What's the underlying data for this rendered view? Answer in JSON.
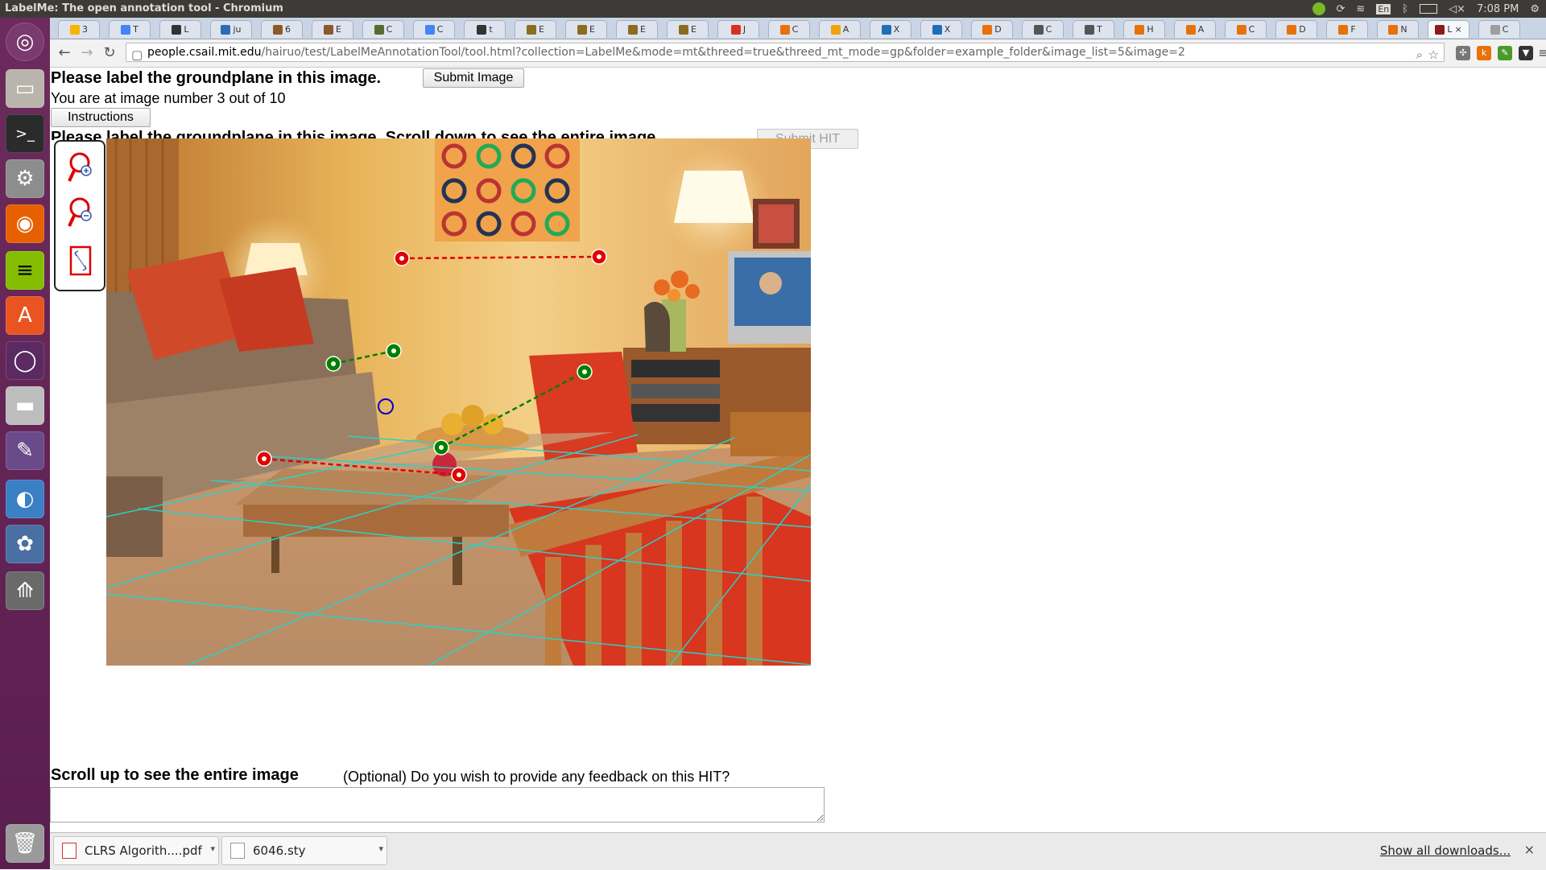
{
  "system_bar": {
    "window_title": "LabelMe: The open annotation tool - Chromium",
    "keyboard_indicator": "En",
    "clock": "7:08 PM"
  },
  "launcher": {
    "items": [
      "ubuntu-dash",
      "files",
      "terminal",
      "system-settings",
      "firefox",
      "spotify",
      "software-center",
      "unity-tweak",
      "drive",
      "text-editor",
      "chromium",
      "shotwell",
      "updater"
    ],
    "trash": "trash"
  },
  "tabs": [
    {
      "label": "3",
      "color": "#f4b400"
    },
    {
      "label": "T",
      "color": "#4285f4"
    },
    {
      "label": "L",
      "color": "#333333"
    },
    {
      "label": "ju",
      "color": "#2a6db5"
    },
    {
      "label": "6",
      "color": "#8b5a2b"
    },
    {
      "label": "E",
      "color": "#8b5a2b"
    },
    {
      "label": "C",
      "color": "#556b2f"
    },
    {
      "label": "C",
      "color": "#4285f4"
    },
    {
      "label": "t",
      "color": "#333333"
    },
    {
      "label": "E",
      "color": "#8a6d1e"
    },
    {
      "label": "E",
      "color": "#8a6d1e"
    },
    {
      "label": "E",
      "color": "#8a6d1e"
    },
    {
      "label": "E",
      "color": "#8a6d1e"
    },
    {
      "label": "J",
      "color": "#d93025"
    },
    {
      "label": "C",
      "color": "#e8710a"
    },
    {
      "label": "A",
      "color": "#f0a30a"
    },
    {
      "label": "X",
      "color": "#1f6fb5"
    },
    {
      "label": "X",
      "color": "#1f6fb5"
    },
    {
      "label": "D",
      "color": "#e8710a"
    },
    {
      "label": "C",
      "color": "#555555"
    },
    {
      "label": "T",
      "color": "#555555"
    },
    {
      "label": "H",
      "color": "#e8710a"
    },
    {
      "label": "A",
      "color": "#e8710a"
    },
    {
      "label": "C",
      "color": "#e8710a"
    },
    {
      "label": "D",
      "color": "#e8710a"
    },
    {
      "label": "F",
      "color": "#e8710a"
    },
    {
      "label": "N",
      "color": "#e8710a"
    },
    {
      "label": "L",
      "color": "#8b1a1a",
      "active": true
    },
    {
      "label": "C",
      "color": "#9e9e9e"
    }
  ],
  "toolbar": {
    "back": "back-arrow",
    "forward": "forward-arrow",
    "reload": "reload",
    "url_host": "people.csail.mit.edu",
    "url_path": "/hairuo/test/LabelMeAnnotationTool/tool.html?collection=LabelMe&mode=mt&threed=true&threed_mt_mode=gp&folder=example_folder&image_list=5&image=2",
    "ext_badge": "k"
  },
  "page": {
    "heading": "Please label the groundplane in this image.",
    "submit_image_label": "Submit Image",
    "progress_text": "You are at image number 3 out of 10",
    "instructions_label": "Instructions",
    "obscured_heading": "Please label the groundplane in this image. Scroll down to see the entire image.",
    "submit_hit_label": "Submit HIT",
    "scroll_up_text": "Scroll up to see the entire image",
    "feedback_prompt": "(Optional) Do you wish to provide any feedback on this HIT?",
    "feedback_value": ""
  },
  "annotation_tools": [
    "zoom-in-icon",
    "zoom-out-icon",
    "fit-screen-icon"
  ],
  "overlay_colors": {
    "red": "#e00000",
    "green": "#008000",
    "blue": "#0000cc",
    "grid": "#2ad1c8"
  },
  "downloads": {
    "items": [
      {
        "name": "CLRS Algorith....pdf",
        "type": "pdf"
      },
      {
        "name": "6046.sty",
        "type": "file"
      }
    ],
    "show_all": "Show all downloads...",
    "close": "×"
  }
}
